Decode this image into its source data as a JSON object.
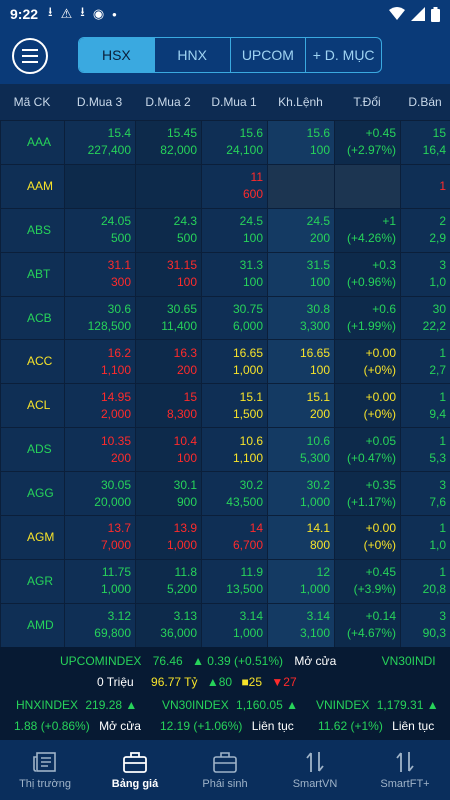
{
  "status": {
    "time": "9:22"
  },
  "tabs": [
    "HSX",
    "HNX",
    "UPCOM",
    "+ D. MỤC"
  ],
  "columns": [
    "Mã CK",
    "D.Mua 3",
    "D.Mua 2",
    "D.Mua 1",
    "Kh.Lệnh",
    "T.Đổi",
    "D.Bán"
  ],
  "rows": [
    {
      "sym": "AAA",
      "sc": "up",
      "b3p": "15.4",
      "b3v": "227,400",
      "b3c": "up",
      "b2p": "15.45",
      "b2v": "82,000",
      "b2c": "up",
      "b1p": "15.6",
      "b1v": "24,100",
      "b1c": "up",
      "mp": "15.6",
      "mv": "100",
      "mc": "up",
      "cp": "+0.45",
      "cv": "(+2.97%)",
      "cc": "up",
      "ap": "15",
      "av": "16,4",
      "ac": "up"
    },
    {
      "sym": "AAM",
      "sc": "ref",
      "b3p": "",
      "b3v": "",
      "b3c": "up",
      "b2p": "",
      "b2v": "",
      "b2c": "up",
      "b1p": "11",
      "b1v": "600",
      "b1c": "down",
      "mp": "",
      "mv": "",
      "mc": "up",
      "cp": "",
      "cv": "",
      "cc": "up",
      "ap": "1",
      "av": "",
      "ac": "down",
      "empty": true
    },
    {
      "sym": "ABS",
      "sc": "up",
      "b3p": "24.05",
      "b3v": "500",
      "b3c": "up",
      "b2p": "24.3",
      "b2v": "500",
      "b2c": "up",
      "b1p": "24.5",
      "b1v": "100",
      "b1c": "up",
      "mp": "24.5",
      "mv": "200",
      "mc": "up",
      "cp": "+1",
      "cv": "(+4.26%)",
      "cc": "up",
      "ap": "2",
      "av": "2,9",
      "ac": "up"
    },
    {
      "sym": "ABT",
      "sc": "up",
      "b3p": "31.1",
      "b3v": "300",
      "b3c": "down",
      "b2p": "31.15",
      "b2v": "100",
      "b2c": "down",
      "b1p": "31.3",
      "b1v": "100",
      "b1c": "up",
      "mp": "31.5",
      "mv": "100",
      "mc": "up",
      "cp": "+0.3",
      "cv": "(+0.96%)",
      "cc": "up",
      "ap": "3",
      "av": "1,0",
      "ac": "up"
    },
    {
      "sym": "ACB",
      "sc": "up",
      "b3p": "30.6",
      "b3v": "128,500",
      "b3c": "up",
      "b2p": "30.65",
      "b2v": "11,400",
      "b2c": "up",
      "b1p": "30.75",
      "b1v": "6,000",
      "b1c": "up",
      "mp": "30.8",
      "mv": "3,300",
      "mc": "up",
      "cp": "+0.6",
      "cv": "(+1.99%)",
      "cc": "up",
      "ap": "30",
      "av": "22,2",
      "ac": "up"
    },
    {
      "sym": "ACC",
      "sc": "ref",
      "b3p": "16.2",
      "b3v": "1,100",
      "b3c": "down",
      "b2p": "16.3",
      "b2v": "200",
      "b2c": "down",
      "b1p": "16.65",
      "b1v": "1,000",
      "b1c": "ref",
      "mp": "16.65",
      "mv": "100",
      "mc": "ref",
      "cp": "+0.00",
      "cv": "(+0%)",
      "cc": "ref",
      "ap": "1",
      "av": "2,7",
      "ac": "up"
    },
    {
      "sym": "ACL",
      "sc": "ref",
      "b3p": "14.95",
      "b3v": "2,000",
      "b3c": "down",
      "b2p": "15",
      "b2v": "8,300",
      "b2c": "down",
      "b1p": "15.1",
      "b1v": "1,500",
      "b1c": "ref",
      "mp": "15.1",
      "mv": "200",
      "mc": "ref",
      "cp": "+0.00",
      "cv": "(+0%)",
      "cc": "ref",
      "ap": "1",
      "av": "9,4",
      "ac": "up"
    },
    {
      "sym": "ADS",
      "sc": "up",
      "b3p": "10.35",
      "b3v": "200",
      "b3c": "down",
      "b2p": "10.4",
      "b2v": "100",
      "b2c": "down",
      "b1p": "10.6",
      "b1v": "1,100",
      "b1c": "ref",
      "mp": "10.6",
      "mv": "5,300",
      "mc": "up",
      "cp": "+0.05",
      "cv": "(+0.47%)",
      "cc": "up",
      "ap": "1",
      "av": "5,3",
      "ac": "up"
    },
    {
      "sym": "AGG",
      "sc": "up",
      "b3p": "30.05",
      "b3v": "20,000",
      "b3c": "up",
      "b2p": "30.1",
      "b2v": "900",
      "b2c": "up",
      "b1p": "30.2",
      "b1v": "43,500",
      "b1c": "up",
      "mp": "30.2",
      "mv": "1,000",
      "mc": "up",
      "cp": "+0.35",
      "cv": "(+1.17%)",
      "cc": "up",
      "ap": "3",
      "av": "7,6",
      "ac": "up"
    },
    {
      "sym": "AGM",
      "sc": "ref",
      "b3p": "13.7",
      "b3v": "7,000",
      "b3c": "down",
      "b2p": "13.9",
      "b2v": "1,000",
      "b2c": "down",
      "b1p": "14",
      "b1v": "6,700",
      "b1c": "down",
      "mp": "14.1",
      "mv": "800",
      "mc": "ref",
      "cp": "+0.00",
      "cv": "(+0%)",
      "cc": "ref",
      "ap": "1",
      "av": "1,0",
      "ac": "up"
    },
    {
      "sym": "AGR",
      "sc": "up",
      "b3p": "11.75",
      "b3v": "1,000",
      "b3c": "up",
      "b2p": "11.8",
      "b2v": "5,200",
      "b2c": "up",
      "b1p": "11.9",
      "b1v": "13,500",
      "b1c": "up",
      "mp": "12",
      "mv": "1,000",
      "mc": "up",
      "cp": "+0.45",
      "cv": "(+3.9%)",
      "cc": "up",
      "ap": "1",
      "av": "20,8",
      "ac": "up"
    },
    {
      "sym": "AMD",
      "sc": "up",
      "b3p": "3.12",
      "b3v": "69,800",
      "b3c": "up",
      "b2p": "3.13",
      "b2v": "36,000",
      "b2c": "up",
      "b1p": "3.14",
      "b1v": "1,000",
      "b1c": "up",
      "mp": "3.14",
      "mv": "3,100",
      "mc": "up",
      "cp": "+0.14",
      "cv": "(+4.67%)",
      "cc": "up",
      "ap": "3",
      "av": "90,3",
      "ac": "up"
    }
  ],
  "ticker": {
    "upcom_name": "UPCOMINDEX",
    "upcom_value": "76.46",
    "upcom_change": "▲ 0.39 (+0.51%)",
    "upcom_status": "Mở cửa",
    "vn30_partial": "VN30INDI",
    "volume": "0 Triệu",
    "value": "96.77 Tỷ",
    "advances": "▲80",
    "unchanged": "■25",
    "declines": "▼27",
    "hnx_name": "HNXINDEX",
    "hnx_value": "219.28 ▲",
    "hnx_change": "1.88 (+0.86%)",
    "hnx_status": "Mở cửa",
    "vn30_name": "VN30INDEX",
    "vn30_value": "1,160.05 ▲",
    "vn30_change": "12.19 (+1.06%)",
    "vn30_status": "Liên tục",
    "vn_name": "VNINDEX",
    "vn_value": "1,179.31 ▲",
    "vn_change": "11.62 (+1%)",
    "vn_status": "Liên tục"
  },
  "nav": [
    "Thị trường",
    "Bảng giá",
    "Phái sinh",
    "SmartVN",
    "SmartFT+"
  ],
  "colors": {
    "up": "#27d35a",
    "down": "#ff2b2b",
    "ref": "#f7e32a",
    "accent": "#3aa9e0"
  }
}
